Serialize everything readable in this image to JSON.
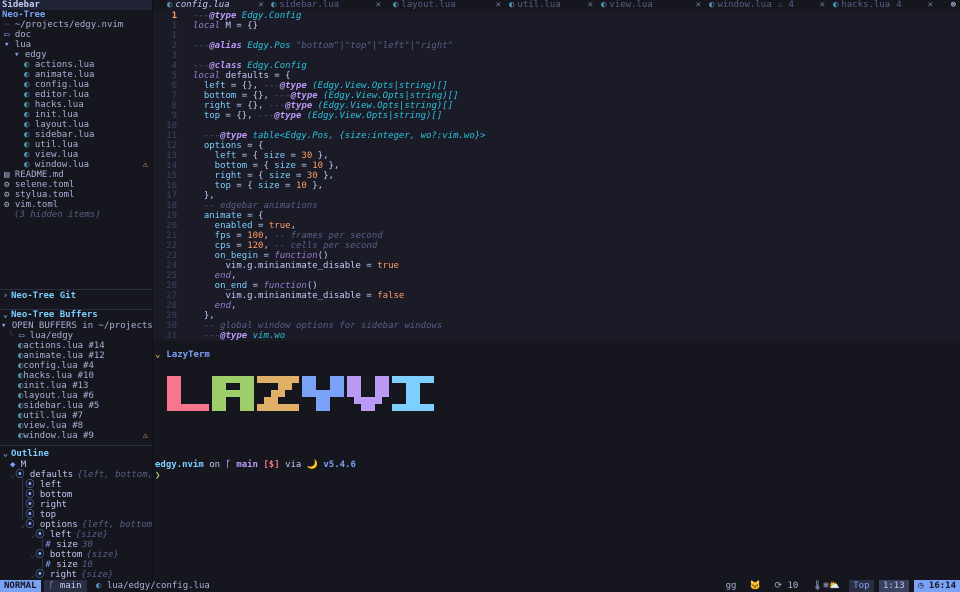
{
  "sidebar": {
    "title": "Sidebar",
    "neotree": {
      "title": "Neo-Tree",
      "root": "~/projects/edgy.nvim",
      "items": [
        {
          "label": "doc",
          "kind": "folder",
          "depth": 1
        },
        {
          "label": "lua",
          "kind": "folder-open",
          "depth": 1
        },
        {
          "label": "edgy",
          "kind": "folder-open",
          "depth": 2
        },
        {
          "label": "actions.lua",
          "kind": "lua",
          "depth": 3
        },
        {
          "label": "animate.lua",
          "kind": "lua",
          "depth": 3
        },
        {
          "label": "config.lua",
          "kind": "lua",
          "depth": 3
        },
        {
          "label": "editor.lua",
          "kind": "lua",
          "depth": 3
        },
        {
          "label": "hacks.lua",
          "kind": "lua",
          "depth": 3
        },
        {
          "label": "init.lua",
          "kind": "lua",
          "depth": 3
        },
        {
          "label": "layout.lua",
          "kind": "lua",
          "depth": 3
        },
        {
          "label": "sidebar.lua",
          "kind": "lua",
          "depth": 3
        },
        {
          "label": "util.lua",
          "kind": "lua",
          "depth": 3
        },
        {
          "label": "view.lua",
          "kind": "lua",
          "depth": 3
        },
        {
          "label": "window.lua",
          "kind": "lua",
          "depth": 3,
          "warning": true
        },
        {
          "label": "README.md",
          "kind": "md",
          "depth": 1
        },
        {
          "label": "selene.toml",
          "kind": "gear",
          "depth": 1
        },
        {
          "label": "stylua.toml",
          "kind": "gear",
          "depth": 1
        },
        {
          "label": "vim.toml",
          "kind": "gear",
          "depth": 1
        }
      ],
      "hidden_note": "(3 hidden items)"
    },
    "git": {
      "title": "Neo-Tree Git"
    },
    "buffers": {
      "title": "Neo-Tree Buffers",
      "root": "OPEN BUFFERS in ~/projects/",
      "folder": "lua/edgy",
      "items": [
        {
          "label": "actions.lua #14"
        },
        {
          "label": "animate.lua #12"
        },
        {
          "label": "config.lua #4"
        },
        {
          "label": "hacks.lua #10"
        },
        {
          "label": "init.lua #13"
        },
        {
          "label": "layout.lua #6"
        },
        {
          "label": "sidebar.lua #5"
        },
        {
          "label": "util.lua #7"
        },
        {
          "label": "view.lua #8"
        },
        {
          "label": "window.lua #9",
          "warning": true
        }
      ]
    },
    "outline": {
      "title": "Outline",
      "items": [
        {
          "label": "M",
          "detail": "",
          "depth": 1,
          "icon": "◆"
        },
        {
          "label": "defaults",
          "detail": "{left, bottom,",
          "depth": 1,
          "icon": "⦿",
          "open": true
        },
        {
          "label": "left",
          "detail": "",
          "depth": 2,
          "icon": "⦿"
        },
        {
          "label": "bottom",
          "detail": "",
          "depth": 2,
          "icon": "⦿"
        },
        {
          "label": "right",
          "detail": "",
          "depth": 2,
          "icon": "⦿"
        },
        {
          "label": "top",
          "detail": "",
          "depth": 2,
          "icon": "⦿"
        },
        {
          "label": "options",
          "detail": "{left, bottom,",
          "depth": 2,
          "icon": "⦿",
          "open": true
        },
        {
          "label": "left",
          "detail": "{size}",
          "depth": 3,
          "icon": "⦿",
          "open": true
        },
        {
          "label": "size",
          "detail": "30",
          "depth": 4,
          "icon": "#"
        },
        {
          "label": "bottom",
          "detail": "{size}",
          "depth": 3,
          "icon": "⦿",
          "open": true
        },
        {
          "label": "size",
          "detail": "10",
          "depth": 4,
          "icon": "#"
        },
        {
          "label": "right",
          "detail": "{size}",
          "depth": 3,
          "icon": "⦿",
          "open": true
        }
      ]
    }
  },
  "tabs": [
    {
      "label": "config.lua",
      "active": true,
      "badge": ""
    },
    {
      "label": "sidebar.lua",
      "active": false,
      "badge": ""
    },
    {
      "label": "layout.lua",
      "active": false,
      "badge": ""
    },
    {
      "label": "util.lua",
      "active": false,
      "badge": ""
    },
    {
      "label": "view.lua",
      "active": false,
      "badge": ""
    },
    {
      "label": "window.lua",
      "active": false,
      "badge": "⚠ 4"
    },
    {
      "label": "hacks.lua",
      "active": false,
      "badge": "4"
    }
  ],
  "editor": {
    "cursor_line": 1,
    "lines": [
      {
        "n": "1",
        "t": [
          [
            "cm",
            "---"
          ],
          [
            "tg",
            "@type"
          ],
          [
            "ty",
            " Edgy.Config"
          ]
        ]
      },
      {
        "n": "1",
        "t": [
          [
            "kw",
            "local"
          ],
          [
            "vr",
            " M = {}"
          ]
        ]
      },
      {
        "n": "1",
        "t": []
      },
      {
        "n": "2",
        "t": [
          [
            "cm",
            "---"
          ],
          [
            "tg",
            "@alias"
          ],
          [
            "ty",
            " Edgy.Pos "
          ],
          [
            "cm",
            "\"bottom\"|\"top\"|\"left\"|\"right\""
          ]
        ]
      },
      {
        "n": "3",
        "t": []
      },
      {
        "n": "4",
        "t": [
          [
            "cm",
            "---"
          ],
          [
            "tg",
            "@class"
          ],
          [
            "ty",
            " Edgy.Config"
          ]
        ]
      },
      {
        "n": "5",
        "t": [
          [
            "kw",
            "local"
          ],
          [
            "vr",
            " defaults = {"
          ]
        ]
      },
      {
        "n": "6",
        "t": [
          [
            "fld",
            "  left"
          ],
          [
            "vr",
            " = {}, "
          ],
          [
            "cm",
            "---"
          ],
          [
            "tg",
            "@type"
          ],
          [
            "ty",
            " (Edgy.View.Opts|string)[]"
          ]
        ]
      },
      {
        "n": "7",
        "t": [
          [
            "fld",
            "  bottom"
          ],
          [
            "vr",
            " = {}, "
          ],
          [
            "cm",
            "---"
          ],
          [
            "tg",
            "@type"
          ],
          [
            "ty",
            " (Edgy.View.Opts|string)[]"
          ]
        ]
      },
      {
        "n": "8",
        "t": [
          [
            "fld",
            "  right"
          ],
          [
            "vr",
            " = {}, "
          ],
          [
            "cm",
            "---"
          ],
          [
            "tg",
            "@type"
          ],
          [
            "ty",
            " (Edgy.View.Opts|string)[]"
          ]
        ]
      },
      {
        "n": "9",
        "t": [
          [
            "fld",
            "  top"
          ],
          [
            "vr",
            " = {}, "
          ],
          [
            "cm",
            "---"
          ],
          [
            "tg",
            "@type"
          ],
          [
            "ty",
            " (Edgy.View.Opts|string)[]"
          ]
        ]
      },
      {
        "n": "10",
        "t": []
      },
      {
        "n": "11",
        "t": [
          [
            "cm",
            "  ---"
          ],
          [
            "tg",
            "@type"
          ],
          [
            "ty",
            " table<Edgy.Pos, {size:integer, wo?:vim.wo}>"
          ]
        ]
      },
      {
        "n": "12",
        "t": [
          [
            "fld",
            "  options"
          ],
          [
            "vr",
            " = {"
          ]
        ]
      },
      {
        "n": "13",
        "t": [
          [
            "fld",
            "    left"
          ],
          [
            "vr",
            " = { "
          ],
          [
            "fld",
            "size"
          ],
          [
            "vr",
            " = "
          ],
          [
            "num",
            "30"
          ],
          [
            "vr",
            " },"
          ]
        ]
      },
      {
        "n": "14",
        "t": [
          [
            "fld",
            "    bottom"
          ],
          [
            "vr",
            " = { "
          ],
          [
            "fld",
            "size"
          ],
          [
            "vr",
            " = "
          ],
          [
            "num",
            "10"
          ],
          [
            "vr",
            " },"
          ]
        ]
      },
      {
        "n": "15",
        "t": [
          [
            "fld",
            "    right"
          ],
          [
            "vr",
            " = { "
          ],
          [
            "fld",
            "size"
          ],
          [
            "vr",
            " = "
          ],
          [
            "num",
            "30"
          ],
          [
            "vr",
            " },"
          ]
        ]
      },
      {
        "n": "16",
        "t": [
          [
            "fld",
            "    top"
          ],
          [
            "vr",
            " = { "
          ],
          [
            "fld",
            "size"
          ],
          [
            "vr",
            " = "
          ],
          [
            "num",
            "10"
          ],
          [
            "vr",
            " },"
          ]
        ]
      },
      {
        "n": "17",
        "t": [
          [
            "vr",
            "  },"
          ]
        ]
      },
      {
        "n": "18",
        "t": [
          [
            "cm",
            "  -- edgebar animations"
          ]
        ]
      },
      {
        "n": "19",
        "t": [
          [
            "fld",
            "  animate"
          ],
          [
            "vr",
            " = {"
          ]
        ]
      },
      {
        "n": "20",
        "t": [
          [
            "fld",
            "    enabled"
          ],
          [
            "vr",
            " = "
          ],
          [
            "bool",
            "true"
          ],
          [
            "vr",
            ","
          ]
        ]
      },
      {
        "n": "21",
        "t": [
          [
            "fld",
            "    fps"
          ],
          [
            "vr",
            " = "
          ],
          [
            "num",
            "100"
          ],
          [
            "vr",
            ", "
          ],
          [
            "cm",
            "-- frames per second"
          ]
        ]
      },
      {
        "n": "22",
        "t": [
          [
            "fld",
            "    cps"
          ],
          [
            "vr",
            " = "
          ],
          [
            "num",
            "120"
          ],
          [
            "vr",
            ", "
          ],
          [
            "cm",
            "-- cells per second"
          ]
        ]
      },
      {
        "n": "23",
        "t": [
          [
            "fld",
            "    on_begin"
          ],
          [
            "vr",
            " = "
          ],
          [
            "kw",
            "function"
          ],
          [
            "vr",
            "()"
          ]
        ]
      },
      {
        "n": "24",
        "t": [
          [
            "vr",
            "      vim.g.minianimate_disable = "
          ],
          [
            "bool",
            "true"
          ]
        ]
      },
      {
        "n": "25",
        "t": [
          [
            "kw",
            "    end"
          ],
          [
            "vr",
            ","
          ]
        ]
      },
      {
        "n": "26",
        "t": [
          [
            "fld",
            "    on_end"
          ],
          [
            "vr",
            " = "
          ],
          [
            "kw",
            "function"
          ],
          [
            "vr",
            "()"
          ]
        ]
      },
      {
        "n": "27",
        "t": [
          [
            "vr",
            "      vim.g.minianimate_disable = "
          ],
          [
            "bool",
            "false"
          ]
        ]
      },
      {
        "n": "28",
        "t": [
          [
            "kw",
            "    end"
          ],
          [
            "vr",
            ","
          ]
        ]
      },
      {
        "n": "29",
        "t": [
          [
            "vr",
            "  },"
          ]
        ]
      },
      {
        "n": "30",
        "t": [
          [
            "cm",
            "  -- global window options for sidebar windows"
          ]
        ]
      },
      {
        "n": "31",
        "t": [
          [
            "cm",
            "  ---"
          ],
          [
            "tg",
            "@type"
          ],
          [
            "ty",
            " vim.wo"
          ]
        ]
      }
    ]
  },
  "terminal": {
    "title": "LazyTerm",
    "banner_letters": [
      {
        "ch": "L",
        "color": "#f7768e"
      },
      {
        "ch": "A",
        "color": "#9ece6a"
      },
      {
        "ch": "Z",
        "color": "#e0af68"
      },
      {
        "ch": "Y",
        "color": "#7aa2f7"
      },
      {
        "ch": "V",
        "color": "#bb9af7"
      },
      {
        "ch": "I",
        "color": "#7dcfff"
      }
    ],
    "prompt": {
      "dir": "edgy.nvim",
      "on": " on ",
      "branch": " main",
      "status": " [$]",
      "via": " via ",
      "lang": "🌙 v5.4.6"
    },
    "caret": "❯"
  },
  "statusline": {
    "mode": "NORMAL",
    "branch": " main",
    "file": "lua/edgy/config.lua",
    "right": [
      "gg",
      "10",
      "Top",
      "1:13",
      "16:14"
    ]
  }
}
